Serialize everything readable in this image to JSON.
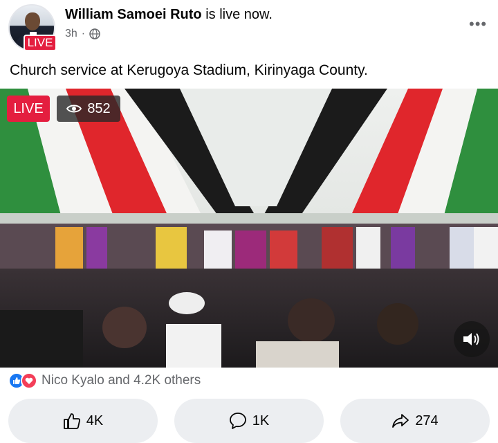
{
  "post": {
    "author": "William Samoei Ruto",
    "status_text": "is live now.",
    "time": "3h",
    "separator": "·",
    "avatar_badge": "LIVE",
    "caption": "Church service at Kerugoya Stadium, Kirinyaga County.",
    "more_icon": "more-dots-icon",
    "privacy_icon": "globe-icon"
  },
  "video": {
    "live_label": "LIVE",
    "viewer_count": "852",
    "viewer_icon": "eye-icon",
    "sound_icon": "speaker-icon"
  },
  "reactions": {
    "summary": "Nico Kyalo and 4.2K others",
    "icons": [
      "like-icon",
      "love-icon"
    ]
  },
  "actions": {
    "like_count": "4K",
    "comment_count": "1K",
    "share_count": "274"
  },
  "colors": {
    "live_red": "#e41e3f",
    "like_blue": "#1877f2",
    "love_red": "#f33e58",
    "action_bg": "#eceef1",
    "muted_text": "#65676b"
  }
}
